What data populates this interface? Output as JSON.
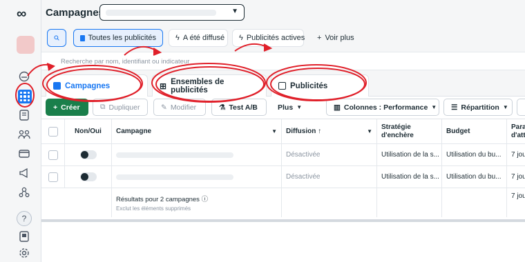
{
  "header": {
    "title": "Campagnes"
  },
  "filters": {
    "all_ads": "Toutes les publicités",
    "delivered": "A été diffusé",
    "active_ads": "Publicités actives",
    "see_more": "Voir plus",
    "search_placeholder": "Recherche par nom, identifiant ou indicateur"
  },
  "tabs": [
    {
      "label": "Campagnes"
    },
    {
      "label": "Ensembles de publicités"
    },
    {
      "label": "Publicités"
    }
  ],
  "toolbar": {
    "create": "Créer",
    "duplicate": "Dupliquer",
    "modify": "Modifier",
    "ab_test": "Test A/B",
    "more": "Plus",
    "columns": "Colonnes : Performance",
    "breakdown": "Répartition"
  },
  "table": {
    "headers": {
      "toggle": "Non/Oui",
      "campaign": "Campagne",
      "delivery": "Diffusion ↑",
      "bid_strategy": "Stratégie d'enchère",
      "budget": "Budget",
      "attribution": "Para d'att"
    },
    "rows": [
      {
        "delivery": "Désactivée",
        "bid_strategy": "Utilisation de la s...",
        "budget": "Utilisation du bu...",
        "attribution": "7 jou"
      },
      {
        "delivery": "Désactivée",
        "bid_strategy": "Utilisation de la s...",
        "budget": "Utilisation du bu...",
        "attribution": "7 jou"
      }
    ],
    "summary": {
      "results": "Résultats pour 2 campagnes",
      "note": "Exclut les éléments supprimés",
      "attribution": "7 jou"
    }
  },
  "colors": {
    "accent": "#1877f2",
    "create_button": "#1a7f4b",
    "annotation": "#e0202a"
  },
  "icons": [
    "meta-logo-icon",
    "search-icon",
    "folder-icon",
    "lightning-icon",
    "plus-icon",
    "grid-icon",
    "columns-icon",
    "breakdown-icon",
    "help-icon",
    "settings-icon"
  ]
}
